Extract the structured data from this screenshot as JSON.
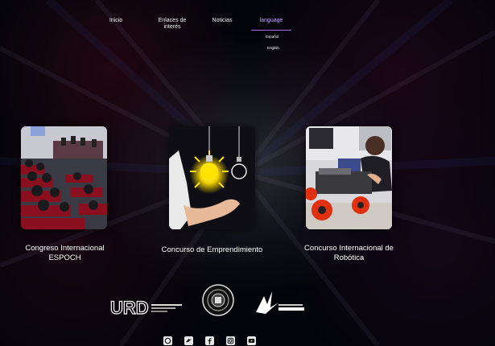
{
  "nav": {
    "items": [
      {
        "label": "Inicio"
      },
      {
        "label": "Enlaces de interés"
      },
      {
        "label": "Noticias"
      },
      {
        "label": "language"
      }
    ],
    "language_menu": [
      "Español",
      "English"
    ]
  },
  "cards": [
    {
      "title": "Congreso Internacional ESPOCH",
      "image": "conference-audience-photo"
    },
    {
      "title": "Concurso de Emprendimiento",
      "image": "hand-lightbulb-photo"
    },
    {
      "title": "Concurso Internacional de Robótica",
      "image": "robot-car-photo"
    }
  ],
  "footer": {
    "logos": [
      {
        "name": "urd-logo",
        "text": "URD"
      },
      {
        "name": "university-seal-logo"
      },
      {
        "name": "bird-logo"
      }
    ],
    "social_icons": [
      "whatsapp-icon",
      "twitter-icon",
      "facebook-icon",
      "instagram-icon",
      "youtube-icon"
    ]
  },
  "colors": {
    "background": "#03040a",
    "accent": "#a070f0",
    "text": "#ffffff"
  }
}
